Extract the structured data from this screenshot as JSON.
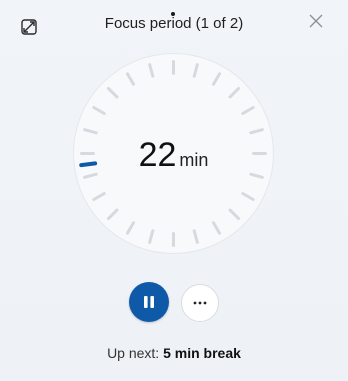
{
  "header": {
    "title": "Focus period (1 of 2)"
  },
  "timer": {
    "minutes": "22",
    "unit": "min",
    "remaining_fraction": 0.73,
    "accent_color": "#0f5aa8"
  },
  "controls": {
    "pause_icon": "pause-icon",
    "more_icon": "ellipsis-icon",
    "more_label": "···"
  },
  "footer": {
    "upnext_label": "Up next:",
    "upnext_value": "5 min break"
  },
  "colors": {
    "background": "#eef2f6",
    "dial_face": "#f7f9fb",
    "tick": "#d6dadf",
    "accent": "#0f5aa8"
  }
}
